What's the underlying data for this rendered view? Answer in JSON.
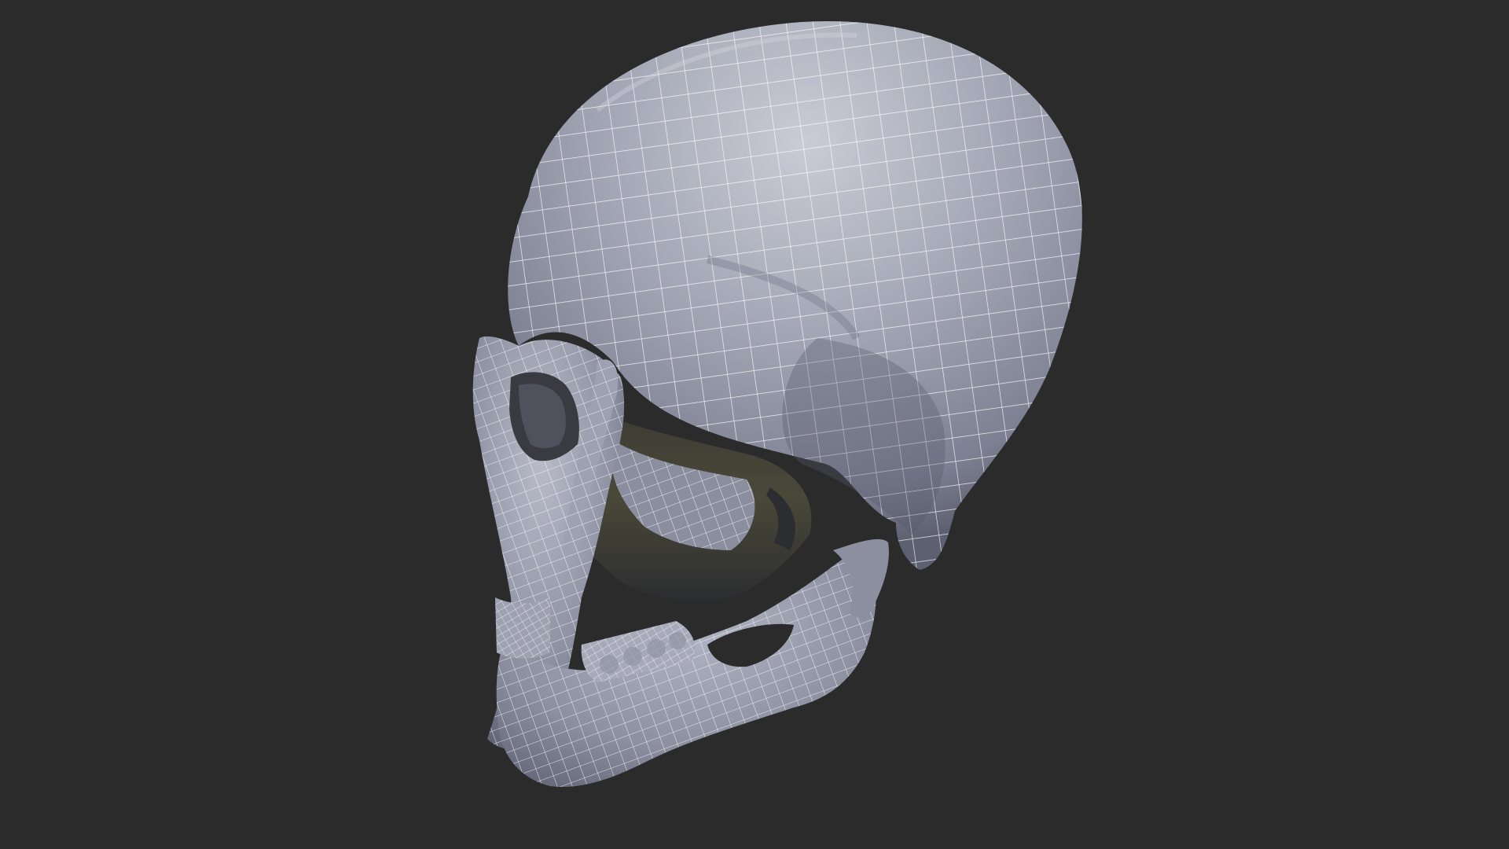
{
  "scene": {
    "subject_icon": "wireframe-skull-icon",
    "colors": {
      "background": "#2b2b2b",
      "mesh_base": "#8e93a4",
      "mesh_highlight": "#c9ccd6",
      "mesh_shadow": "#4e5262",
      "cavity": "#2a2c30",
      "cavity_warm": "#4a4838",
      "wire": "#ffffff"
    }
  }
}
